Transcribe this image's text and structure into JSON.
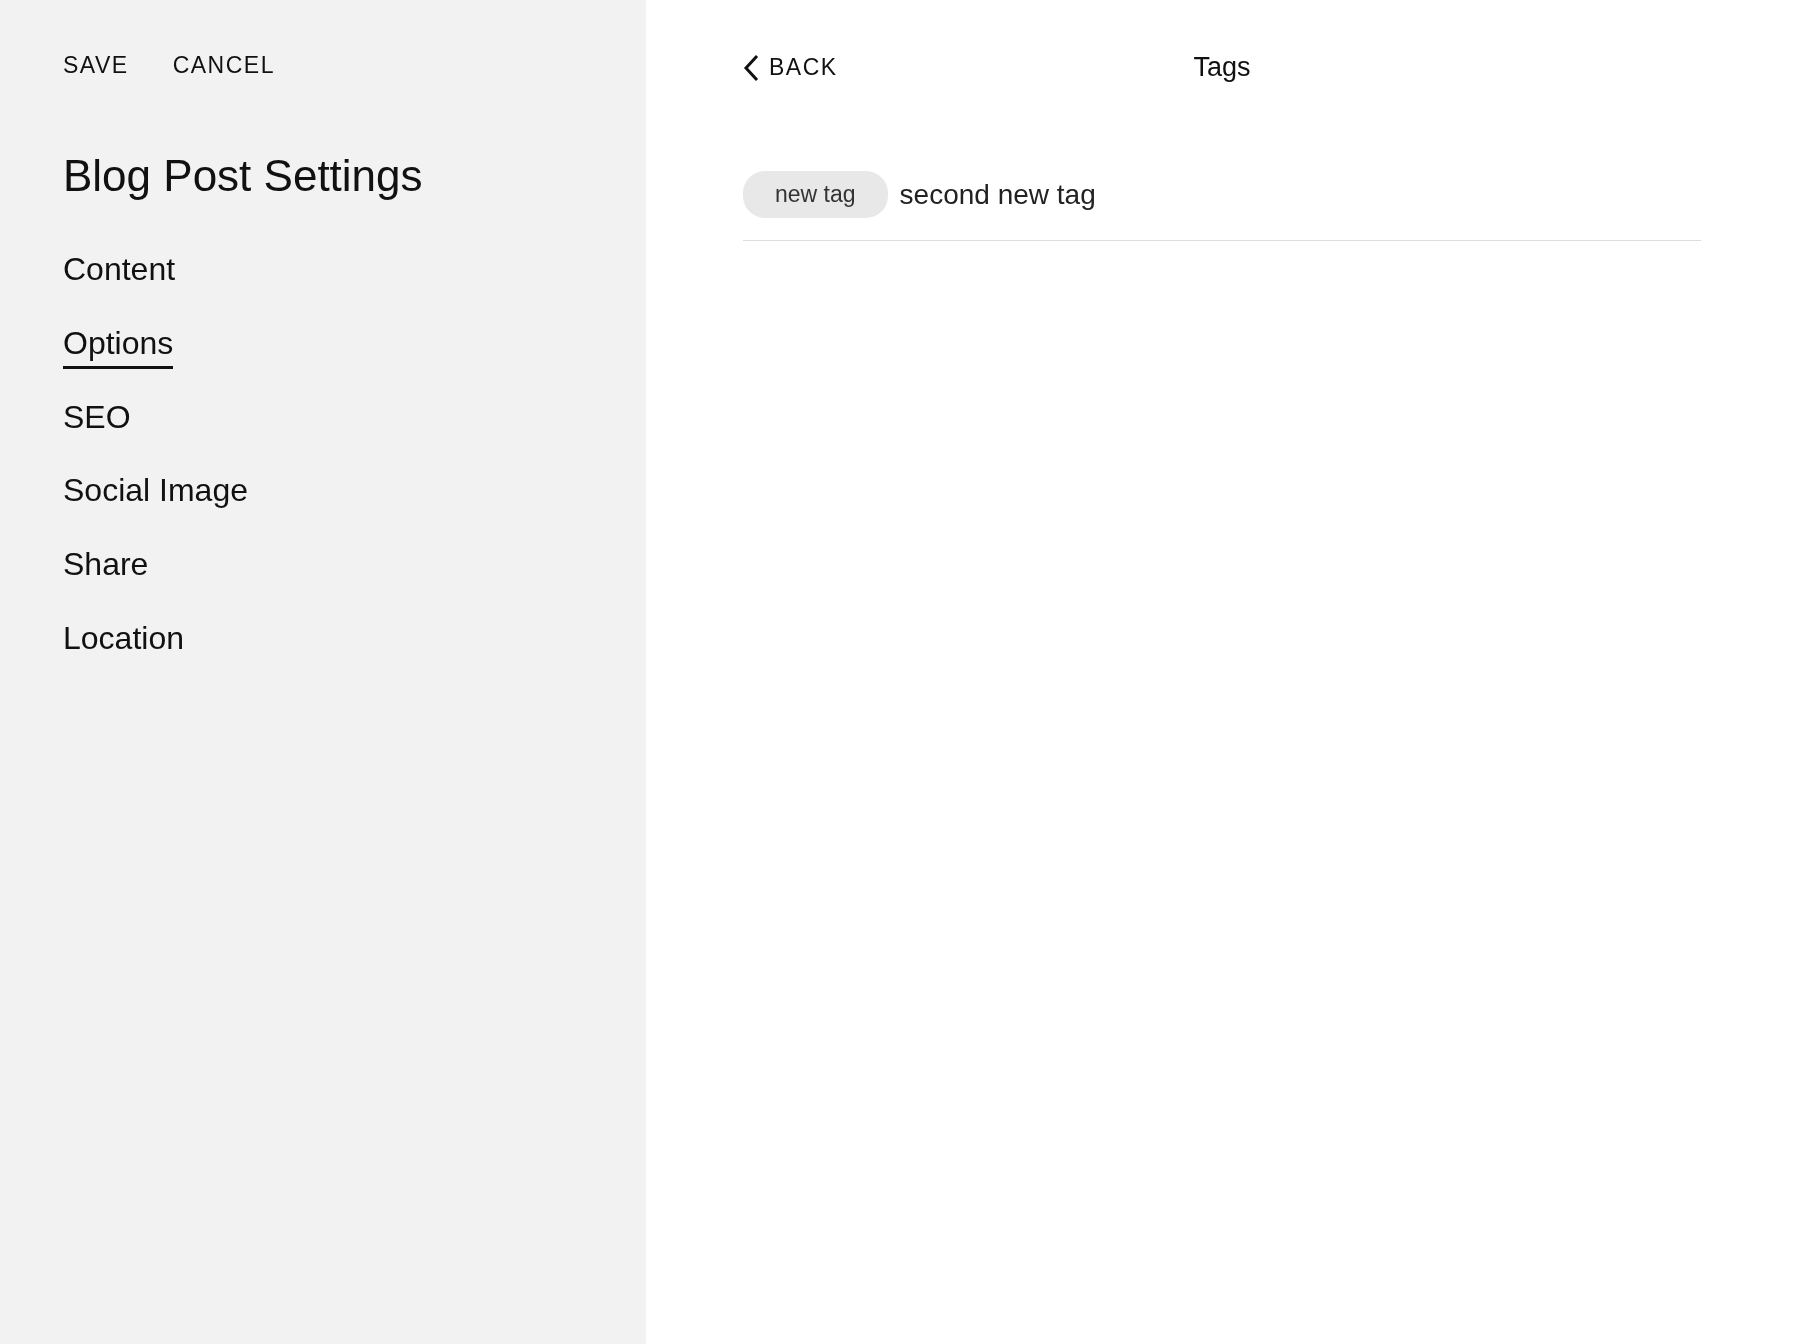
{
  "toolbar": {
    "buttons": [
      "SAVE",
      "CANCEL"
    ]
  },
  "sidebar": {
    "title": "Blog Post Settings",
    "items": [
      {
        "label": "Content",
        "selected": false
      },
      {
        "label": "Options",
        "selected": true
      },
      {
        "label": "SEO",
        "selected": false
      },
      {
        "label": "Social Image",
        "selected": false
      },
      {
        "label": "Share",
        "selected": false
      },
      {
        "label": "Location",
        "selected": false
      }
    ]
  },
  "panel": {
    "back": "BACK",
    "title": "Tags",
    "tags": [
      "new tag"
    ],
    "input_value": "second new tag"
  }
}
